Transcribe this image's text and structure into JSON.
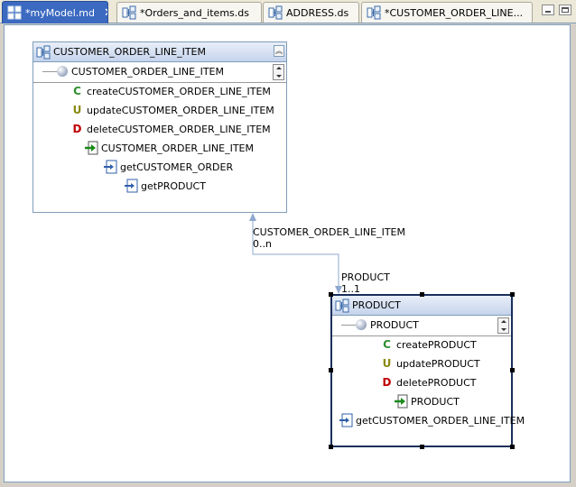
{
  "tabs": [
    {
      "label": "*myModel.md",
      "active": true
    },
    {
      "label": "*Orders_and_items.ds",
      "active": false
    },
    {
      "label": "ADDRESS.ds",
      "active": false
    },
    {
      "label": "*CUSTOMER_ORDER_LINE...",
      "active": false
    }
  ],
  "entities": {
    "customer_order_line_item": {
      "title": "CUSTOMER_ORDER_LINE_ITEM",
      "attribute": "CUSTOMER_ORDER_LINE_ITEM",
      "create": "createCUSTOMER_ORDER_LINE_ITEM",
      "update": "updateCUSTOMER_ORDER_LINE_ITEM",
      "delete": "deleteCUSTOMER_ORDER_LINE_ITEM",
      "read": "CUSTOMER_ORDER_LINE_ITEM",
      "nav1": "getCUSTOMER_ORDER",
      "nav2": "getPRODUCT"
    },
    "product": {
      "title": "PRODUCT",
      "attribute": "PRODUCT",
      "create": "createPRODUCT",
      "update": "updatePRODUCT",
      "delete": "deletePRODUCT",
      "read": "PRODUCT",
      "nav1": "getCUSTOMER_ORDER_LINE_ITEM"
    }
  },
  "badges": {
    "create": "C",
    "update": "U",
    "delete": "D"
  },
  "relationship": {
    "source_role": "CUSTOMER_ORDER_LINE_ITEM",
    "source_multiplicity": "0..n",
    "target_role": "PRODUCT",
    "target_multiplicity": "1..1"
  },
  "colors": {
    "active_tab": "#3c6ac1",
    "connector": "#8fa8cf",
    "create": "#2f8f2f",
    "update": "#8a8a10",
    "delete": "#c00000"
  },
  "icons": [
    "model-icon",
    "datasource-icon",
    "close-icon",
    "minimize-icon",
    "maximize-icon",
    "attribute-icon",
    "read-icon",
    "navigate-icon"
  ]
}
